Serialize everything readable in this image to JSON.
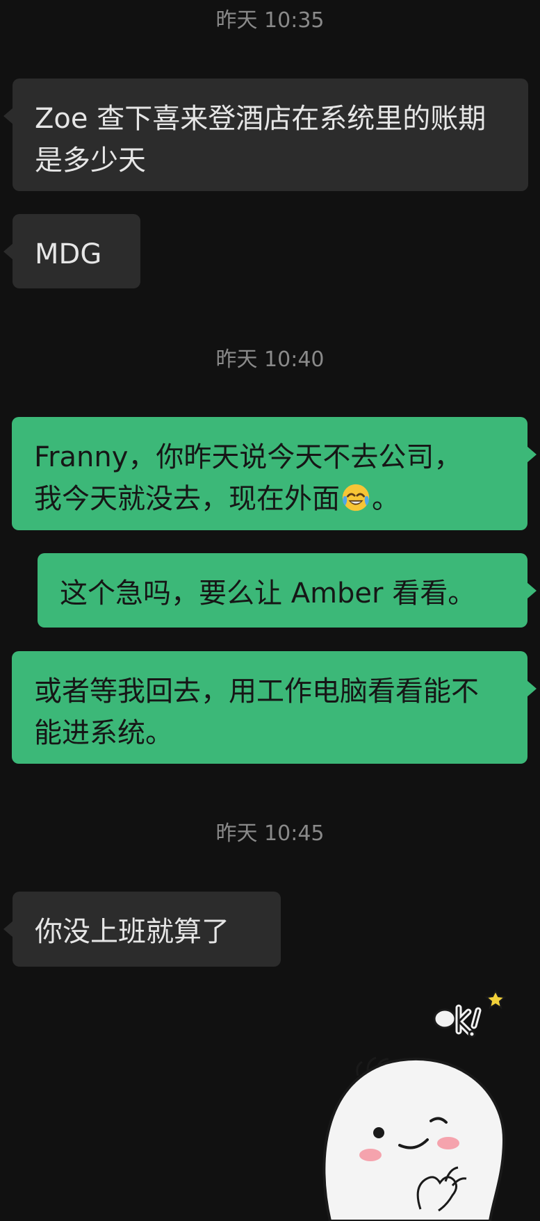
{
  "conversation": {
    "timestamps": [
      "昨天 10:35",
      "昨天 10:40",
      "昨天 10:45"
    ],
    "messages": [
      {
        "side": "in",
        "text": "Zoe 查下喜来登酒店在系统里的账期是多少天"
      },
      {
        "side": "in",
        "text": "MDG"
      },
      {
        "side": "out",
        "line1": "Franny，你昨天说今天不去公司，",
        "line2a": "我今天就没去，现在外面",
        "line2b": "。",
        "emoji": "face-with-tears-of-joy"
      },
      {
        "side": "out",
        "text": "这个急吗，要么让 Amber 看看。"
      },
      {
        "side": "out",
        "text": "或者等我回去，用工作电脑看看能不能进系统。"
      },
      {
        "side": "in",
        "text": "你没上班就算了"
      }
    ],
    "sticker": {
      "label": "ok!",
      "icon": "ok-gesture-character-sticker"
    }
  },
  "colors": {
    "background": "#111111",
    "incoming_bubble": "#2c2c2c",
    "outgoing_bubble": "#3cb878",
    "timestamp": "#8a8a8a"
  }
}
